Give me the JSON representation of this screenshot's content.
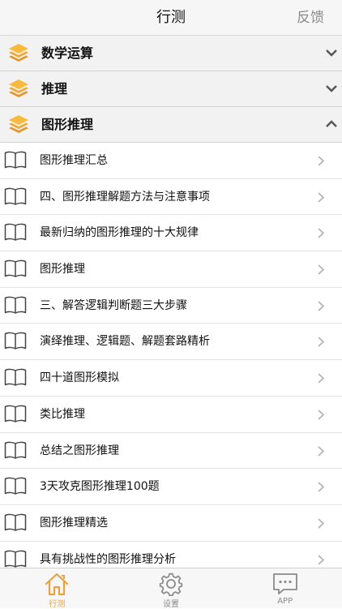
{
  "navbar": {
    "title": "行测",
    "right_button": "反馈"
  },
  "categories": [
    {
      "label": "数学运算",
      "expanded": false
    },
    {
      "label": "推理",
      "expanded": false
    },
    {
      "label": "图形推理",
      "expanded": true
    }
  ],
  "items": [
    "图形推理汇总",
    "四、图形推理解题方法与注意事项",
    "最新归纳的图形推理的十大规律",
    "图形推理",
    "三、解答逻辑判断题三大步骤",
    "演绎推理、逻辑题、解题套路精析",
    "四十道图形模拟",
    "类比推理",
    "总结之图形推理",
    "3天攻克图形推理100题",
    "图形推理精选",
    "具有挑战性的图形推理分析"
  ],
  "tabbar": {
    "tabs": [
      {
        "label": "行测",
        "icon": "home-icon",
        "active": true
      },
      {
        "label": "设置",
        "icon": "gear-icon",
        "active": false
      },
      {
        "label": "APP",
        "icon": "chat-icon",
        "active": false
      }
    ]
  },
  "colors": {
    "accent": "#e8a33c",
    "stack_icon": "#f0a830",
    "nav_bg": "#f6f6f6",
    "category_bg": "#f2f2f2"
  }
}
